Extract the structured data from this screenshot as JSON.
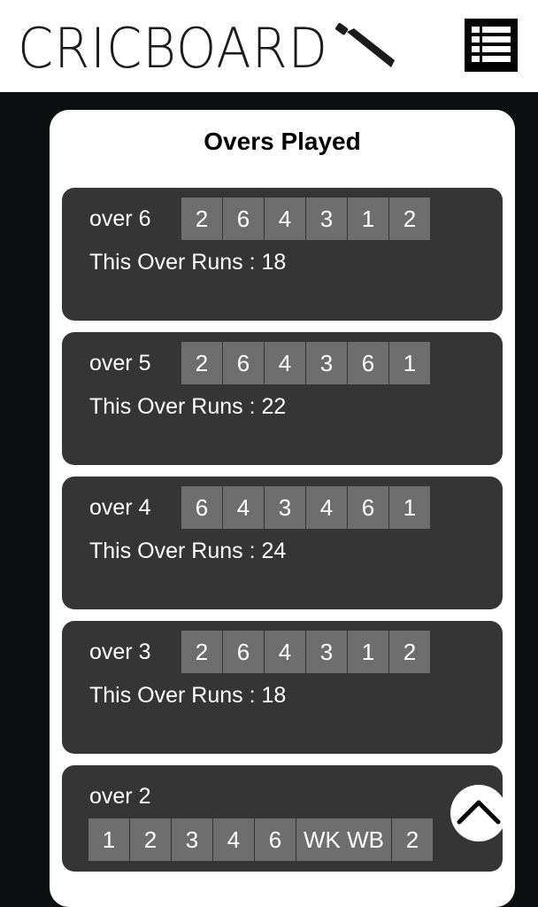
{
  "brand": {
    "name": "CRICBOARD",
    "logo_icon": "cricket-bat-icon"
  },
  "menu": {
    "icon": "menu-icon"
  },
  "section": {
    "title": "Overs Played"
  },
  "overs": [
    {
      "label": "over 6",
      "balls": [
        "2",
        "6",
        "4",
        "3",
        "1",
        "2"
      ],
      "runs_text": "This Over Runs : 18"
    },
    {
      "label": "over 5",
      "balls": [
        "2",
        "6",
        "4",
        "3",
        "6",
        "1"
      ],
      "runs_text": "This Over Runs : 22"
    },
    {
      "label": "over 4",
      "balls": [
        "6",
        "4",
        "3",
        "4",
        "6",
        "1"
      ],
      "runs_text": "This Over Runs : 24"
    },
    {
      "label": "over 3",
      "balls": [
        "2",
        "6",
        "4",
        "3",
        "1",
        "2"
      ],
      "runs_text": "This Over Runs : 18"
    },
    {
      "label": "over 2",
      "balls": [
        "1",
        "2",
        "3",
        "4",
        "6",
        "WK WB",
        "2"
      ]
    }
  ],
  "scroll_top": {
    "icon": "chevron-up-icon"
  },
  "colors": {
    "background": "#0d0e10",
    "card": "#353535",
    "ball": "#6e6e6e",
    "header": "#ffffff"
  }
}
